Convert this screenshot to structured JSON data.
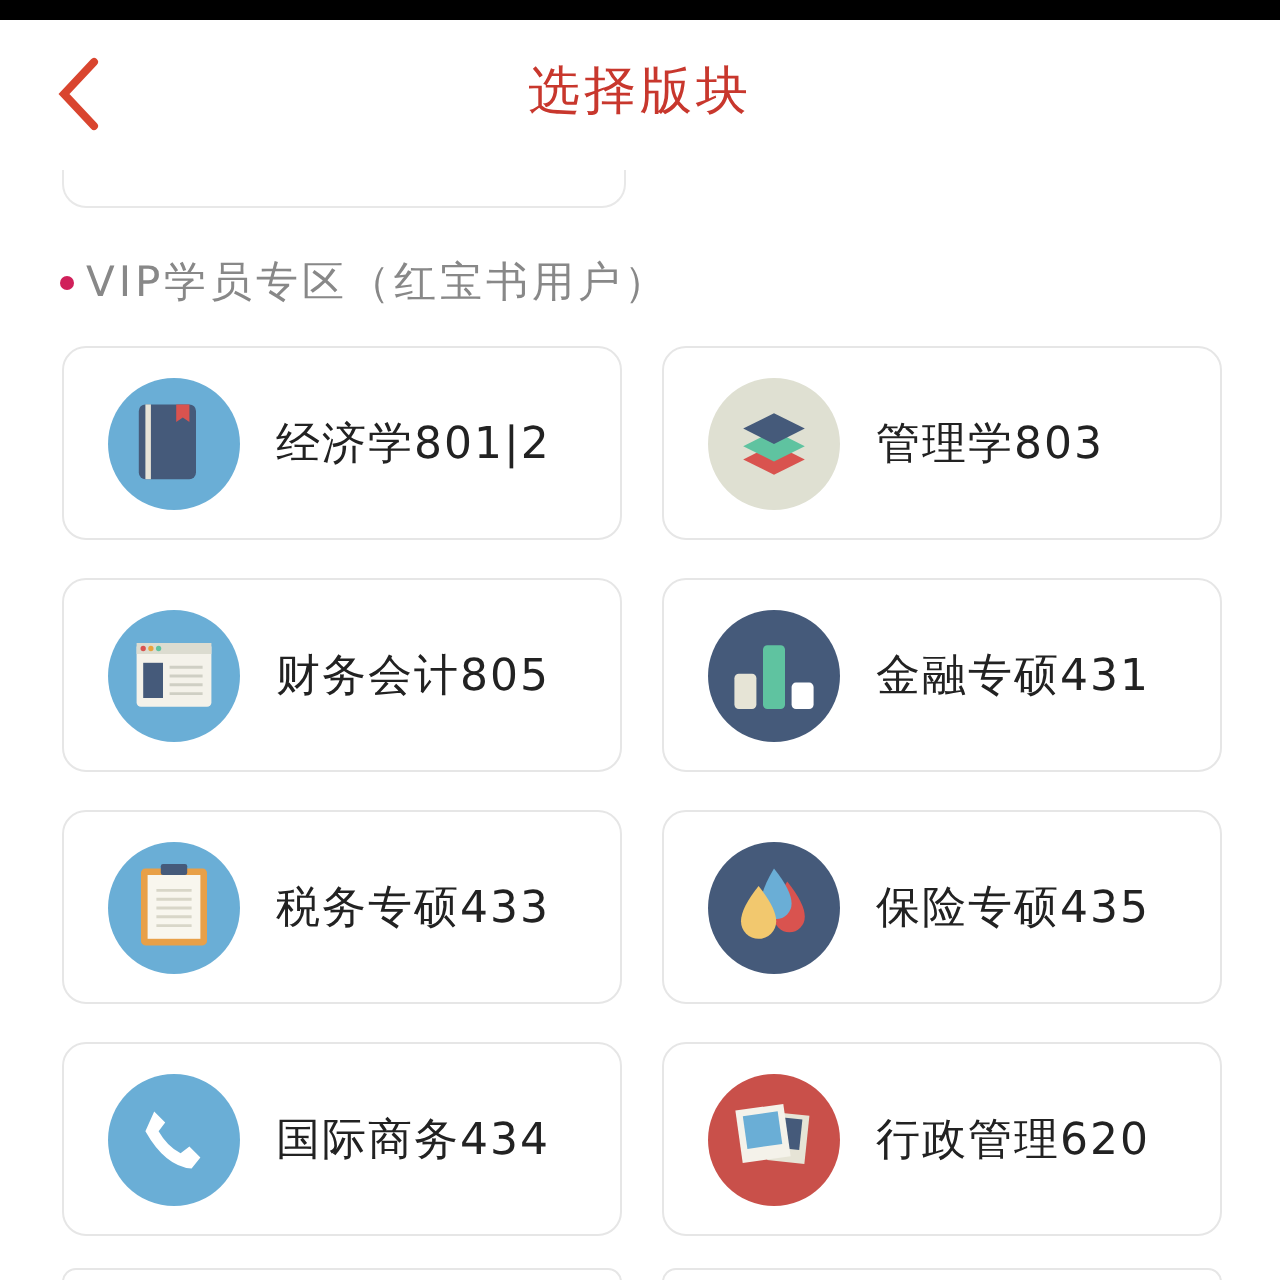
{
  "header": {
    "title": "选择版块"
  },
  "section": {
    "title": "VIP学员专区（红宝书用户）"
  },
  "boards": [
    {
      "label": "经济学801|2"
    },
    {
      "label": "管理学803"
    },
    {
      "label": "财务会计805"
    },
    {
      "label": "金融专硕431"
    },
    {
      "label": "税务专硕433"
    },
    {
      "label": "保险专硕435"
    },
    {
      "label": "国际商务434"
    },
    {
      "label": "行政管理620"
    }
  ]
}
